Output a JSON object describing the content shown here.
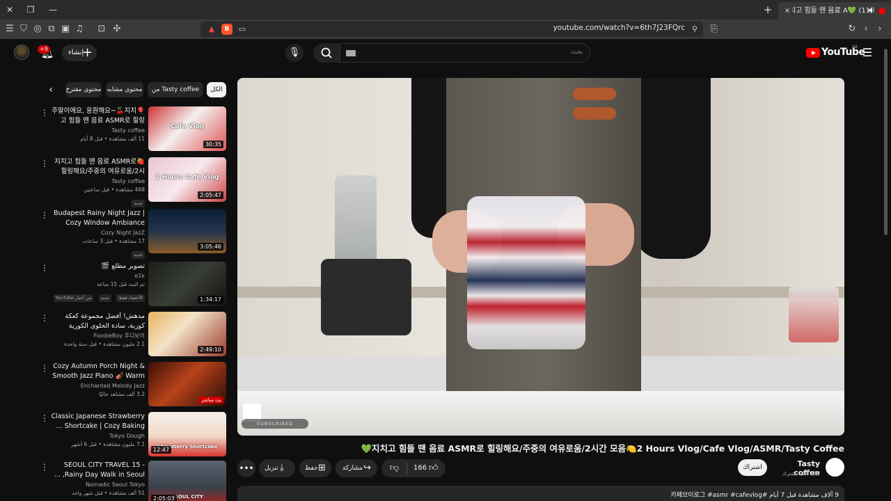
{
  "browser": {
    "tab": {
      "title": "(11) 💚지치고 힘들 땐 음료 A",
      "close_label": "×",
      "new_tab_label": "+"
    },
    "url": "youtube.com/watch?v=6th7J23FQrc",
    "window_controls": [
      "close-icon",
      "maximize-icon",
      "minimize-icon"
    ]
  },
  "masthead": {
    "create_label": "إنشاء",
    "notification_count": "+9",
    "search_placeholder": "بحث",
    "logo_text": "YouTube",
    "region": "SA"
  },
  "chips": {
    "items": [
      "الكل",
      "من Tasty coffee",
      "محتوى مشابه",
      "محتوى مقترح"
    ],
    "selected_index": 0
  },
  "recommendations": [
    {
      "title": "🎈주말이에요, 응원해요~🍒지치고 힘들 땐 음료 ASMR로 힐링",
      "channel": "Tasty coffee",
      "meta": "11 ألف مشاهدة • قبل 8 أيام",
      "duration": "30:35",
      "thumb_text": "Cafe Vlog",
      "badge": ""
    },
    {
      "title": "🍓지치고 힘들 땐 음료 ASMR로 힐링해요/주중의 여유로움/2시",
      "channel": "Tasty coffee",
      "meta": "468 مشاهدة • قبل ساعتين",
      "duration": "2:05:47",
      "thumb_text": "2 Hours Cafe Vlog",
      "badge": "جديد"
    },
    {
      "title": "Budapest Rainy Night Jazz | Cozy Window Ambiance With ...",
      "channel": "Cozy Night JazZ",
      "meta": "17 مشاهدة • قبل 3 ساعات",
      "duration": "3:05:46",
      "thumb_text": "",
      "badge": "جديد"
    },
    {
      "title": "تصوير مطلع 🎬",
      "channel": "e1k",
      "meta": "تم البث قبل 15 ساعة",
      "duration": "1:34:17",
      "thumb_text": "",
      "badge": "جديد",
      "extra": "من أخبار YouTube",
      "extra2": "الأعضاء فقط"
    },
    {
      "title": "مدهش! أفضل مجموعة كعكة كورية، سادة الحلوى الكورية",
      "channel": "FoodieBoy 푸디보이",
      "meta": "2.1 مليون مشاهدة • قبل سنة واحدة",
      "duration": "2:49:10",
      "thumb_text": "",
      "badge": ""
    },
    {
      "title": "Cozy Autumn Porch Night & Smooth Jazz Piano 🎻 Warm ...",
      "channel": "Enchanted Melody Jazz",
      "meta": "3.2 ألف مشاهد حاليًا",
      "duration": "",
      "live": "بث مباشر",
      "thumb_text": "",
      "badge": ""
    },
    {
      "title": "Classic Japanese Strawberry Shortcake | Cozy Baking ...",
      "channel": "Tokyo Dough",
      "meta": "7.1 مليون مشاهدة • قبل 6 أشهر",
      "duration": "12:47",
      "thumb_text": "Strawberry Shortcake",
      "badge": ""
    },
    {
      "title": "SEOUL CITY TRAVEL 15 - Rainy Day Walk in Seoul, ...",
      "channel": "Nomadic Seoul Tokyo",
      "meta": "51 ألف مشاهدة • قبل شهر واحد",
      "duration": "2:05:03",
      "thumb_text": "SEOUL CITY",
      "badge": ""
    }
  ],
  "player": {
    "subscribed_overlay": "SUBSCRIBED"
  },
  "video": {
    "title": "💚지치고 힘들 땐 음료 ASMR로 힐링해요/주중의 여유로움/2시간 모음🍋2 Hours Vlog/Cafe Vlog/ASMR/Tasty Coffee",
    "like_count": "166",
    "share_label": "مشاركة",
    "save_label": "حفظ",
    "download_label": "تنزيل",
    "subscribe_label": "اشتراك",
    "channel_name": "Tasty coffee",
    "channel_subs": "389 ألف مشترك",
    "description_line": "9 آلاف مشاهدة قبل 7 أيام  #카페브이로그 #asmr #cafevlog"
  }
}
